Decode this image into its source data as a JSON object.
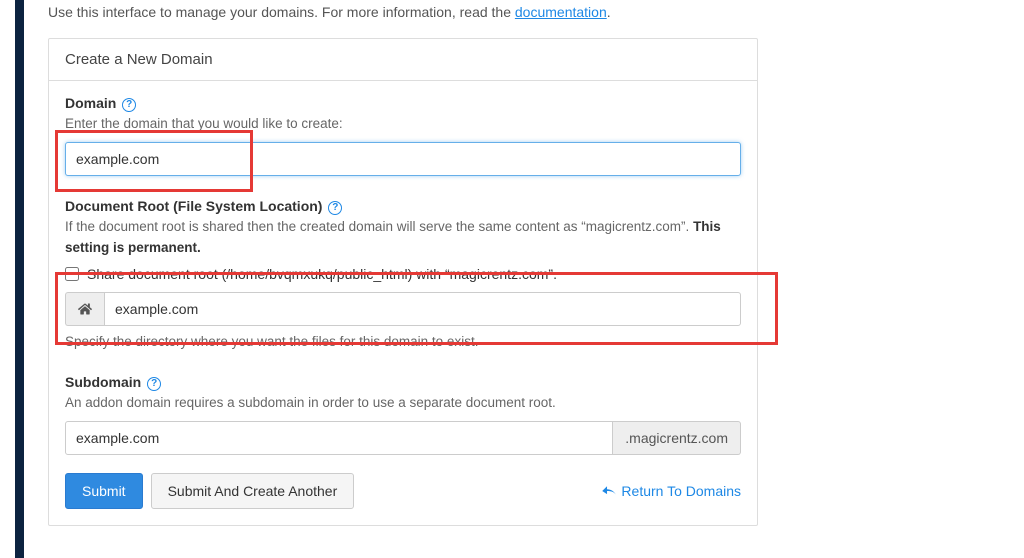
{
  "intro": {
    "text_before": "Use this interface to manage your domains. For more information, read the ",
    "doc_link": "documentation",
    "text_after": "."
  },
  "panel": {
    "title": "Create a New Domain"
  },
  "domain": {
    "label": "Domain",
    "help": "Enter the domain that you would like to create:",
    "value": "example.com"
  },
  "docroot": {
    "label": "Document Root (File System Location)",
    "help_before": "If the document root is shared then the created domain will serve the same content as “magicrentz.com”. ",
    "help_strong": "This setting is permanent.",
    "share_label": "Share document root (/home/bvqmxukq/public_html) with “magicrentz.com”.",
    "value": "example.com",
    "below_help": "Specify the directory where you want the files for this domain to exist."
  },
  "subdomain": {
    "label": "Subdomain",
    "help": "An addon domain requires a subdomain in order to use a separate document root.",
    "value": "example.com",
    "suffix": ".magicrentz.com"
  },
  "buttons": {
    "submit": "Submit",
    "submit_another": "Submit And Create Another",
    "return": "Return To Domains"
  }
}
